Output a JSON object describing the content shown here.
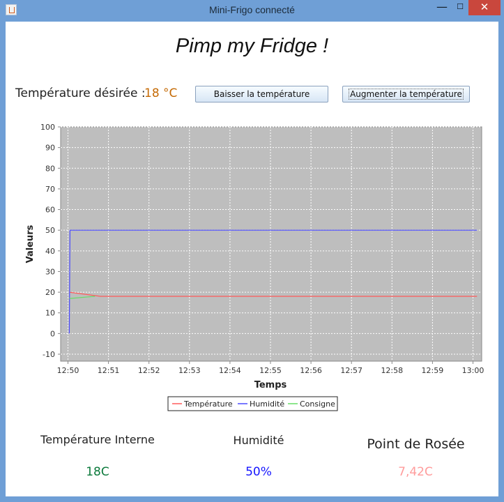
{
  "window": {
    "title": "Mini-Frigo connecté"
  },
  "header": {
    "title": "Pimp my Fridge !"
  },
  "controls": {
    "desired_label": "Température désirée :",
    "desired_value": "18 °C",
    "lower_button": "Baisser la température",
    "raise_button": "Augmenter la température"
  },
  "stats": {
    "internal_label": "Température Interne",
    "internal_value": "18C",
    "humidity_label": "Humidité",
    "humidity_value": "50%",
    "dewpoint_label": "Point de Rosée",
    "dewpoint_value": "7,42C"
  },
  "colors": {
    "temperature": "#ff5a5a",
    "humidity": "#4b4bff",
    "consigne": "#66dd66",
    "internal_value": "#0c7a3c",
    "humidity_value": "#1515ff",
    "dewpoint_value": "#ff9c9c",
    "desired_value": "#c56a05"
  },
  "chart_data": {
    "type": "line",
    "title": "",
    "xlabel": "Temps",
    "ylabel": "Valeurs",
    "ylim": [
      -10,
      100
    ],
    "yticks": [
      -10,
      0,
      10,
      20,
      30,
      40,
      50,
      60,
      70,
      80,
      90,
      100
    ],
    "xlim": [
      "12:50",
      "13:00"
    ],
    "xticks": [
      "12:50",
      "12:51",
      "12:52",
      "12:53",
      "12:54",
      "12:55",
      "12:56",
      "12:57",
      "12:58",
      "12:59",
      "13:00"
    ],
    "grid": true,
    "legend": "bottom",
    "series": [
      {
        "name": "Température",
        "x": [
          "12:50:02",
          "12:50:48",
          "13:00:06"
        ],
        "values": [
          20,
          18,
          18
        ]
      },
      {
        "name": "Humidité",
        "x": [
          "12:50:02",
          "12:50:03",
          "13:00:06"
        ],
        "values": [
          0,
          50,
          50
        ]
      },
      {
        "name": "Consigne",
        "x": [
          "12:50:02",
          "12:50:04",
          "12:50:40"
        ],
        "values": [
          17,
          17,
          18
        ]
      }
    ]
  }
}
